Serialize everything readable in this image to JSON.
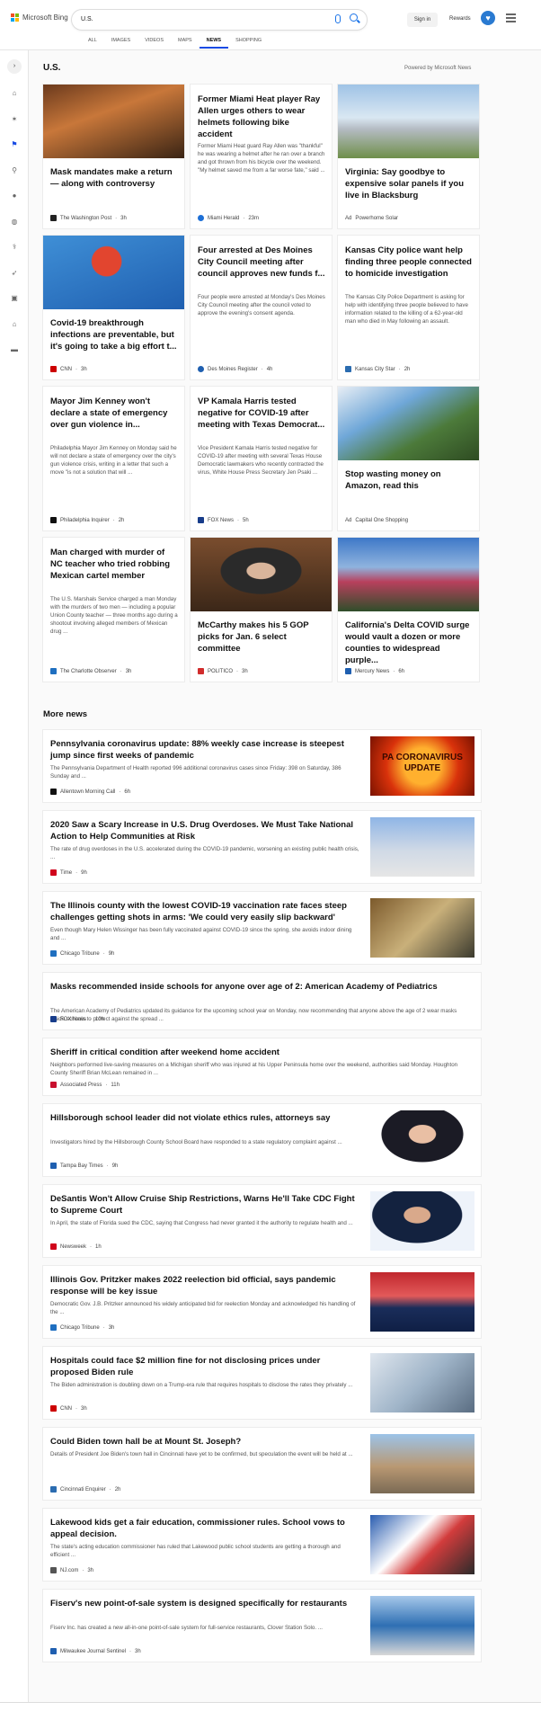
{
  "header": {
    "brand": "Microsoft Bing",
    "query": "U.S.",
    "sign_in": "Sign in",
    "rewards": "Rewards",
    "tabs": [
      "ALL",
      "IMAGES",
      "VIDEOS",
      "MAPS",
      "NEWS",
      "SHOPPING"
    ]
  },
  "section": {
    "title": "U.S.",
    "powered": "Powered by Microsoft News",
    "more": "More news"
  },
  "cards": [
    {
      "title": "Mask mandates make a return — along with controversy",
      "snippet": "",
      "source": "The Washington Post",
      "time": "3h"
    },
    {
      "title": "Former Miami Heat player Ray Allen urges others to wear helmets following bike accident",
      "snippet": "Former Miami Heat guard Ray Allen was \"thankful\" he was wearing a helmet after he ran over a branch and got thrown from his bicycle over the weekend. \"My helmet saved me from a far worse fate,\" said ...",
      "source": "Miami Herald",
      "time": "23m"
    },
    {
      "title": "Virginia: Say goodbye to expensive solar panels if you live in Blacksburg",
      "snippet": "",
      "source": "Powerhome Solar",
      "time": "Ad"
    },
    {
      "title": "Covid-19 breakthrough infections are preventable, but it's going to take a big effort t...",
      "snippet": "",
      "source": "CNN",
      "time": "3h"
    },
    {
      "title": "Four arrested at Des Moines City Council meeting after council approves new funds f...",
      "snippet": "Four people were arrested at Monday's Des Moines City Council meeting after the council voted to approve the evening's consent agenda.",
      "source": "Des Moines Register",
      "time": "4h"
    },
    {
      "title": "Kansas City police want help finding three people connected to homicide investigation",
      "snippet": "The Kansas City Police Department is asking for help with identifying three people believed to have information related to the killing of a 62-year-old man who died in May following an assault.",
      "source": "Kansas City Star",
      "time": "2h"
    },
    {
      "title": "Mayor Jim Kenney won't declare a state of emergency over gun violence in...",
      "snippet": "Philadelphia Mayor Jim Kenney on Monday said he will not declare a state of emergency over the city's gun violence crisis, writing in a letter that such a move \"is not a solution that will ...",
      "source": "Philadelphia Inquirer",
      "time": "2h"
    },
    {
      "title": "VP Kamala Harris tested negative for COVID-19 after meeting with Texas Democrat...",
      "snippet": "Vice President Kamala Harris tested negative for COVID-19 after meeting with several Texas House Democratic lawmakers who recently contracted the virus, White House Press Secretary Jen Psaki ...",
      "source": "FOX News",
      "time": "5h"
    },
    {
      "title": "Stop wasting money on Amazon, read this",
      "snippet": "",
      "source": "Capital One Shopping",
      "time": "Ad"
    },
    {
      "title": "Man charged with murder of NC teacher who tried robbing Mexican cartel member",
      "snippet": "The U.S. Marshals Service charged a man Monday with the murders of two men — including a popular Union County teacher — three months ago during a shootout involving alleged members of Mexican drug ...",
      "source": "The Charlotte Observer",
      "time": "3h"
    },
    {
      "title": "McCarthy makes his 5 GOP picks for Jan. 6 select committee",
      "snippet": "",
      "source": "POLITICO",
      "time": "3h"
    },
    {
      "title": "California's Delta COVID surge would vault a dozen or more counties to widespread purple...",
      "snippet": "",
      "source": "Mercury News",
      "time": "6h"
    }
  ],
  "news": [
    {
      "title": "Pennsylvania coronavirus update: 88% weekly case increase is steepest jump since first weeks of pandemic",
      "snippet": "The Pennsylvania Department of Health reported 996 additional coronavirus cases since Friday: 398 on Saturday, 386 Sunday and ...",
      "source": "Allentown Morning Call",
      "time": "6h",
      "thumb_text": "PA CORONAVIRUS UPDATE"
    },
    {
      "title": "2020 Saw a Scary Increase in U.S. Drug Overdoses. We Must Take National Action to Help Communities at Risk",
      "snippet": "The rate of drug overdoses in the U.S. accelerated during the COVID-19 pandemic, worsening an existing public health crisis, ...",
      "source": "Time",
      "time": "9h"
    },
    {
      "title": "The Illinois county with the lowest COVID-19 vaccination rate faces steep challenges getting shots in arms: 'We could very easily slip backward'",
      "snippet": "Even though Mary Helen Wissinger has been fully vaccinated against COVID-19 since the spring, she avoids indoor dining and ...",
      "source": "Chicago Tribune",
      "time": "9h"
    },
    {
      "title": "Masks recommended inside schools for anyone over age of 2: American Academy of Pediatrics",
      "snippet": "The American Academy of Pediatrics updated its guidance for the upcoming school year on Monday, now recommending that anyone above the age of 2 wear masks inside schools to protect against the spread ...",
      "source": "FOX News",
      "time": "10h"
    },
    {
      "title": "Sheriff in critical condition after weekend home accident",
      "snippet": "Neighbors performed live-saving measures on a Michigan sheriff who was injured at his Upper Peninsula home over the weekend, authorities said Monday. Houghton County Sheriff Brian McLean remained in ...",
      "source": "Associated Press",
      "time": "11h"
    },
    {
      "title": "Hillsborough school leader did not violate ethics rules, attorneys say",
      "snippet": "Investigators hired by the Hillsborough County School Board have responded to a state regulatory complaint against ...",
      "source": "Tampa Bay Times",
      "time": "9h"
    },
    {
      "title": "DeSantis Won't Allow Cruise Ship Restrictions, Warns He'll Take CDC Fight to Supreme Court",
      "snippet": "In April, the state of Florida sued the CDC, saying that Congress had never granted it the authority to regulate health and ...",
      "source": "Newsweek",
      "time": "1h"
    },
    {
      "title": "Illinois Gov. Pritzker makes 2022 reelection bid official, says pandemic response will be key issue",
      "snippet": "Democratic Gov. J.B. Pritzker announced his widely anticipated bid for reelection Monday and acknowledged his handling of the ...",
      "source": "Chicago Tribune",
      "time": "3h"
    },
    {
      "title": "Hospitals could face $2 million fine for not disclosing prices under proposed Biden rule",
      "snippet": "The Biden administration is doubling down on a Trump-era rule that requires hospitals to disclose the rates they privately ...",
      "source": "CNN",
      "time": "3h"
    },
    {
      "title": "Could Biden town hall be at Mount St. Joseph?",
      "snippet": "Details of President Joe Biden's town hall in Cincinnati have yet to be confirmed, but speculation the event will be held at ...",
      "source": "Cincinnati Enquirer",
      "time": "2h"
    },
    {
      "title": "Lakewood kids get a fair education, commissioner rules. School vows to appeal decision.",
      "snippet": "The state's acting education commissioner has ruled that Lakewood public school students are getting a thorough and efficient ...",
      "source": "NJ.com",
      "time": "3h"
    },
    {
      "title": "Fiserv's new point-of-sale system is designed specifically for restaurants",
      "snippet": "Fiserv Inc. has created a new all-in-one point-of-sale system for full-service restaurants, Clover Station Solo. ...",
      "source": "Milwaukee Journal Sentinel",
      "time": "3h"
    }
  ]
}
